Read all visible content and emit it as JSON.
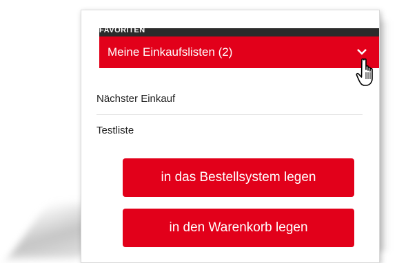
{
  "favorites": {
    "section_label": "FAVORITEN"
  },
  "shopping_lists": {
    "header_title": "Meine Einkaufslisten (2)",
    "items": [
      {
        "label": "Nächster Einkauf"
      },
      {
        "label": "Testliste"
      }
    ]
  },
  "actions": {
    "order_system_label": "in das Bestellsystem legen",
    "cart_label": "in den Warenkorb legen"
  },
  "icons": {
    "chevron": "chevron-down-icon",
    "cursor": "hand-pointer-cursor-icon"
  },
  "colors": {
    "accent_red": "#e2001a",
    "dark_band": "#2b2b2b",
    "text": "#222222"
  }
}
